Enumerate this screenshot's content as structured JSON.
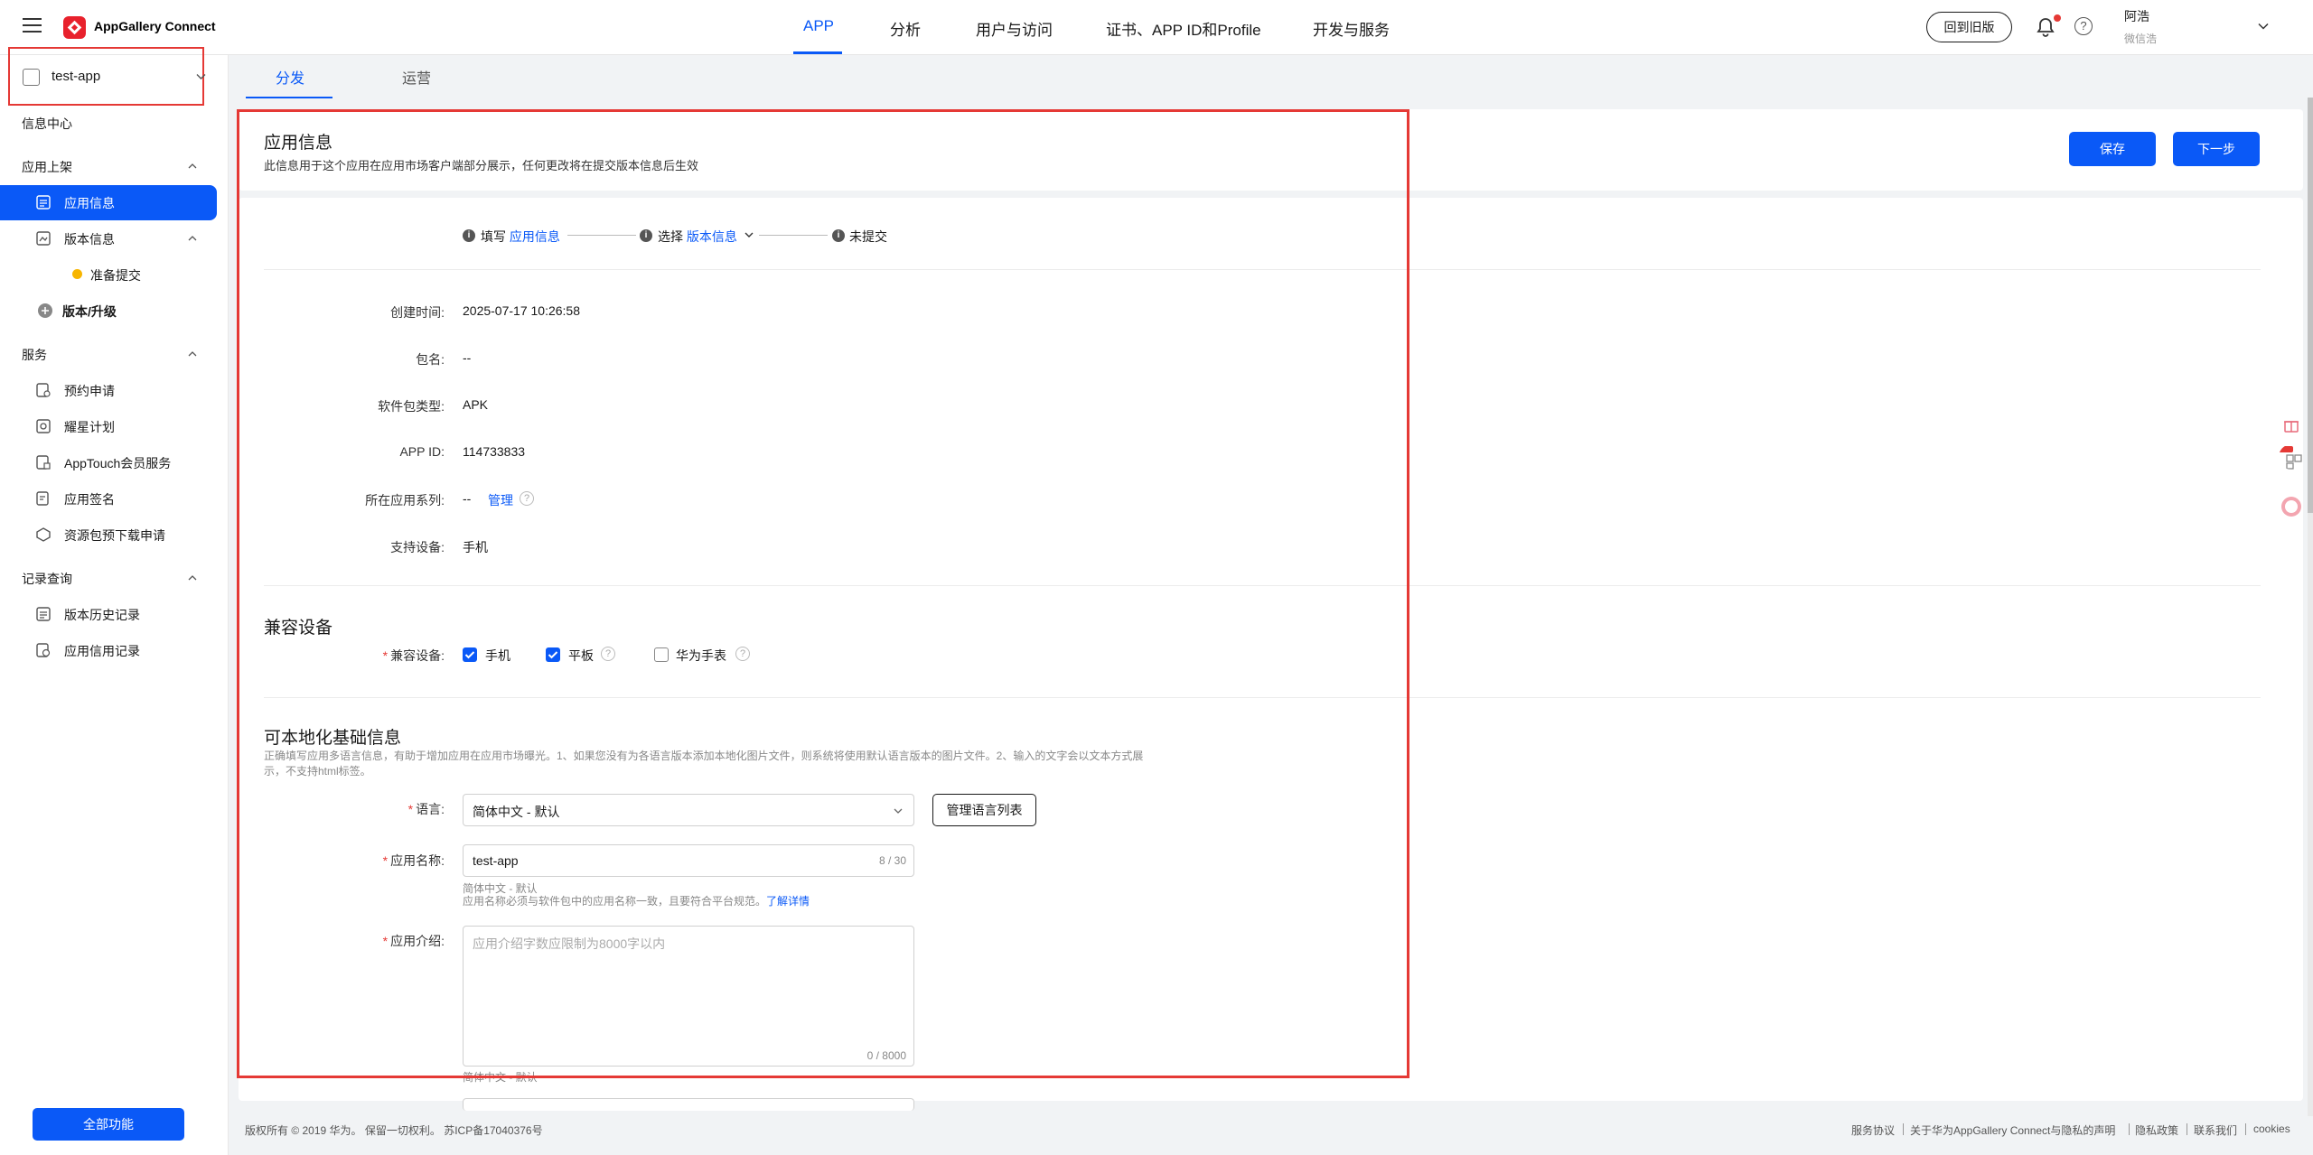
{
  "brand": {
    "name": "AppGallery Connect"
  },
  "topnav": [
    {
      "label": "APP",
      "active": true
    },
    {
      "label": "分析"
    },
    {
      "label": "用户与访问"
    },
    {
      "label": "证书、APP ID和Profile"
    },
    {
      "label": "开发与服务"
    }
  ],
  "header": {
    "back_old": "回到旧版",
    "user_name": "阿浩",
    "user_sub": "微信浩"
  },
  "sidebar": {
    "app_name": "test-app",
    "info_center": "信息中心",
    "group_release": "应用上架",
    "app_info": "应用信息",
    "version_info": "版本信息",
    "prepare_submit": "准备提交",
    "version_upgrade": "版本/升级",
    "group_service": "服务",
    "services": [
      "预约申请",
      "耀星计划",
      "AppTouch会员服务",
      "应用签名",
      "资源包预下载申请"
    ],
    "group_records": "记录查询",
    "records": [
      "版本历史记录",
      "应用信用记录"
    ],
    "all_functions": "全部功能"
  },
  "tabs": [
    "分发",
    "运营"
  ],
  "page": {
    "title": "应用信息",
    "subtitle": "此信息用于这个应用在应用市场客户端部分展示，任何更改将在提交版本信息后生效",
    "save": "保存",
    "next": "下一步"
  },
  "steps": {
    "s1_pre": "填写",
    "s1_link": "应用信息",
    "s2_pre": "选择",
    "s2_link": "版本信息",
    "s3": "未提交"
  },
  "info": {
    "created_label": "创建时间:",
    "created": "2025-07-17 10:26:58",
    "pkg_label": "包名:",
    "pkg": "--",
    "type_label": "软件包类型:",
    "type": "APK",
    "appid_label": "APP ID:",
    "appid": "114733833",
    "series_label": "所在应用系列:",
    "series": "--",
    "manage": "管理",
    "device_label": "支持设备:",
    "device": "手机"
  },
  "compat": {
    "title": "兼容设备",
    "label": "兼容设备:",
    "options": [
      {
        "label": "手机",
        "checked": true
      },
      {
        "label": "平板",
        "checked": true
      },
      {
        "label": "华为手表",
        "checked": false
      }
    ]
  },
  "local": {
    "title": "可本地化基础信息",
    "desc1": "正确填写应用多语言信息，有助于增加应用在应用市场曝光。1、如果您没有为各语言版本添加本地化图片文件，则系统将使用默认语言版本的图片文件。2、输入的文字会以文本方式展",
    "desc2": "示，不支持html标签。",
    "lang_label": "语言:",
    "lang_value": "简体中文 - 默认",
    "manage_lang": "管理语言列表",
    "name_label": "应用名称:",
    "name_value": "test-app",
    "name_count": "8 / 30",
    "name_hint1": "简体中文 - 默认",
    "name_hint2": "应用名称必须与软件包中的应用名称一致，且要符合平台规范。",
    "learn_more": "了解详情",
    "intro_label": "应用介绍:",
    "intro_placeholder": "应用介绍字数应限制为8000字以内",
    "intro_count": "0 / 8000",
    "intro_hint": "简体中文 - 默认"
  },
  "footer": {
    "copyright": "版权所有 © 2019 华为。 保留一切权利。 苏ICP备17040376号",
    "links": [
      "服务协议",
      "关于华为AppGallery Connect与隐私的声明",
      "隐私政策",
      "联系我们",
      "cookies"
    ]
  },
  "colors": {
    "accent": "#0a59f7",
    "highlight": "#e53935",
    "warning_dot": "#f7b500"
  },
  "icons": [
    "hamburger-icon",
    "logo-icon",
    "bell-icon",
    "help-icon",
    "chevron-down-icon",
    "app-icon",
    "info-icon",
    "question-icon",
    "checkbox-icon",
    "gift-icon",
    "qr-icon",
    "translate-icon"
  ]
}
